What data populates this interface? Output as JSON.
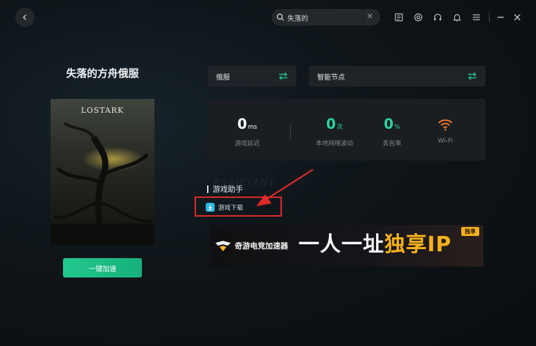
{
  "header": {
    "search_value": "失落的",
    "clear_glyph": "×"
  },
  "game": {
    "title": "失落的方舟俄服",
    "cover_logo": "LOSTARK",
    "accelerate_label": "一键加速"
  },
  "selectors": {
    "region": "俄服",
    "node": "智能节点"
  },
  "stats": [
    {
      "value": "0",
      "unit": "ms",
      "label": "游戏延迟",
      "color": "#ffffff"
    },
    {
      "value": "0",
      "unit": "次",
      "label": "本地网络波动",
      "color": "#2bd4a0"
    },
    {
      "value": "0",
      "unit": "%",
      "label": "丢包率",
      "color": "#2bd4a0"
    },
    {
      "icon": "wifi-icon",
      "label": "Wi-Fi",
      "color": "#f07a2a"
    }
  ],
  "assistant": {
    "watermark": "ASSISTANT",
    "title": "游戏助手",
    "download_label": "游戏下载"
  },
  "banner": {
    "brand": "奇游电竞加速器",
    "slogan_white": "一人一址",
    "slogan_gold": "独享IP",
    "tag": "独享"
  },
  "colors": {
    "accent_green": "#1fbf88",
    "annotation_red": "#e02a2a",
    "gold": "#f6b21c"
  }
}
